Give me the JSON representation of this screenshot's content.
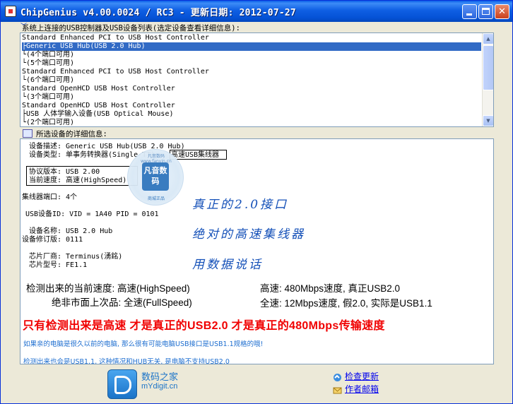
{
  "window": {
    "title": "ChipGenius v4.00.0024 / RC3 - 更新日期: 2012-07-27"
  },
  "device_list": {
    "header": "系统上连接的USB控制器及USB设备列表(选定设备查看详细信息):",
    "items": [
      {
        "text": "Standard Enhanced PCI to USB Host Controller",
        "selected": false
      },
      {
        "text": "├Generic USB Hub(USB 2.0 Hub)",
        "selected": true
      },
      {
        "text": "  └(4个端口可用)",
        "selected": false
      },
      {
        "text": "└(5个端口可用)",
        "selected": false
      },
      {
        "text": "Standard Enhanced PCI to USB Host Controller",
        "selected": false
      },
      {
        "text": "└(6个端口可用)",
        "selected": false
      },
      {
        "text": "Standard OpenHCD USB Host Controller",
        "selected": false
      },
      {
        "text": "└(3个端口可用)",
        "selected": false
      },
      {
        "text": "Standard OpenHCD USB Host Controller",
        "selected": false
      },
      {
        "text": "├USB 人体学输入设备(USB Optical Mouse)",
        "selected": false
      },
      {
        "text": "└(2个端口可用)",
        "selected": false
      }
    ]
  },
  "details": {
    "header": "所选设备的详细信息:",
    "lines": {
      "desc": "设备描述: Generic USB Hub(USB 2.0 Hub)",
      "type_label": "设备类型: 单事务转换器(Single-TT)",
      "type_boxed": "高速USB集线器",
      "proto": "协议版本: USB 2.00",
      "speed": "当前速度: 高速(HighSpeed)",
      "ports": "集线器端口: 4个",
      "usbid": "USB设备ID: VID = 1A40 PID = 0101",
      "devname": "设备名称: USB 2.0 Hub",
      "rev": "设备修订版: 0111",
      "vendor": "芯片厂商: Terminus(湧銘)",
      "model": "芯片型号: FE1.1"
    },
    "stamp": {
      "ring_top": "凡音数码 www.fanyin.cn",
      "center": "凡音数码",
      "bottom": "商城正品"
    },
    "annotations": {
      "hand1": "真正的2.0接口",
      "hand2": "绝对的高速集线器",
      "hand3": "用数据说话",
      "detected": "检测出来的当前速度: 高速(HighSpeed)",
      "high_desc": "高速: 480Mbps速度, 真正USB2.0",
      "market": "绝非市面上次品: 全速(FullSpeed)",
      "full_desc": "全速: 12Mbps速度, 假2.0, 实际是USB1.1",
      "red_note": "只有检测出来是高速 才是真正的USB2.0 才是真正的480Mbps传输速度",
      "blue_note1": "如果亲的电脑是很久以前的电脑, 那么很有可能电脑USB接口是USB1.1规格的哦!",
      "blue_note2": "检测出来也会是USB1.1, 这种情况和HUB无关, 是电脑不支持USB2.0"
    }
  },
  "footer": {
    "logo_name": "数码之家",
    "logo_site": "mYdigit.cn",
    "check_update": "检查更新",
    "author_email": "作者邮箱"
  },
  "colors": {
    "title_bar": "#0552d6",
    "selection": "#316ac5",
    "red_note": "#f00000",
    "blue_note": "#1f6fd0",
    "handwriting": "#1450b8"
  }
}
